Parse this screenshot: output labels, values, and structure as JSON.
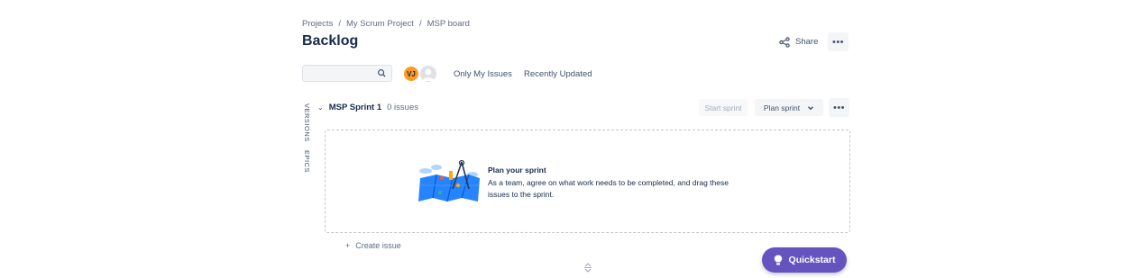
{
  "breadcrumb": [
    "Projects",
    "My Scrum Project",
    "MSP board"
  ],
  "page_title": "Backlog",
  "header_actions": {
    "share_label": "Share",
    "more_label": "•••"
  },
  "filters": {
    "search_placeholder": "",
    "avatar_initials": "VJ",
    "only_my_issues": "Only My Issues",
    "recently_updated": "Recently Updated"
  },
  "side_tabs": {
    "versions": "VERSIONS",
    "epics": "EPICS"
  },
  "sprint": {
    "name": "MSP Sprint 1",
    "count": "0 issues",
    "start_label": "Start sprint",
    "plan_label": "Plan sprint",
    "more_label": "•••"
  },
  "empty_state": {
    "title": "Plan your sprint",
    "text": "As a team, agree on what work needs to be completed, and drag these issues to the sprint."
  },
  "create_issue": {
    "plus": "+",
    "label": "Create issue"
  },
  "quickstart_label": "Quickstart",
  "colors": {
    "accent": "#6554c0",
    "avatar": "#ff991f",
    "text": "#172b4d"
  }
}
